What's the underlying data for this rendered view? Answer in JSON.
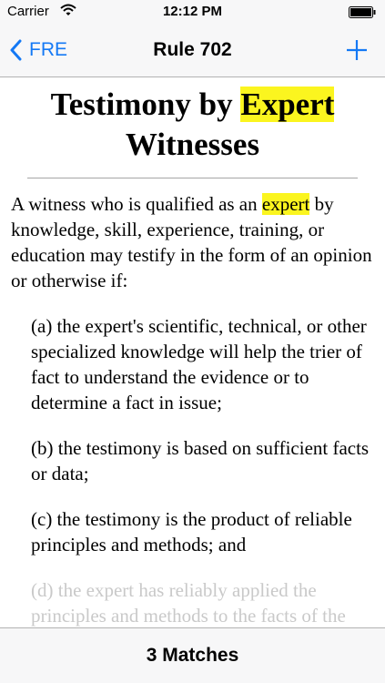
{
  "status_bar": {
    "carrier": "Carrier",
    "time": "12:12 PM"
  },
  "nav": {
    "back_label": "FRE",
    "title": "Rule 702"
  },
  "rule": {
    "title_part1": "Testimony by ",
    "title_highlight": "Expert",
    "title_part2": "Witnesses",
    "intro_part1": "A witness who is qualified as an ",
    "intro_highlight": "expert",
    "intro_part2": " by knowledge, skill, experience, training, or education may testify in the form of an opinion or otherwise if:",
    "clauses": [
      "(a) the expert's scientific, technical, or other specialized knowledge will help the trier of fact to understand the evidence or to determine a fact in issue;",
      "(b) the testimony is based on sufficient facts or data;",
      "(c) the testimony is the product of reliable principles and methods; and",
      "(d) the expert has reliably applied the principles and methods to the facts of the case."
    ]
  },
  "search": {
    "matches_label": "3 Matches"
  },
  "colors": {
    "accent": "#1479f5",
    "highlight": "#fbf51f"
  }
}
